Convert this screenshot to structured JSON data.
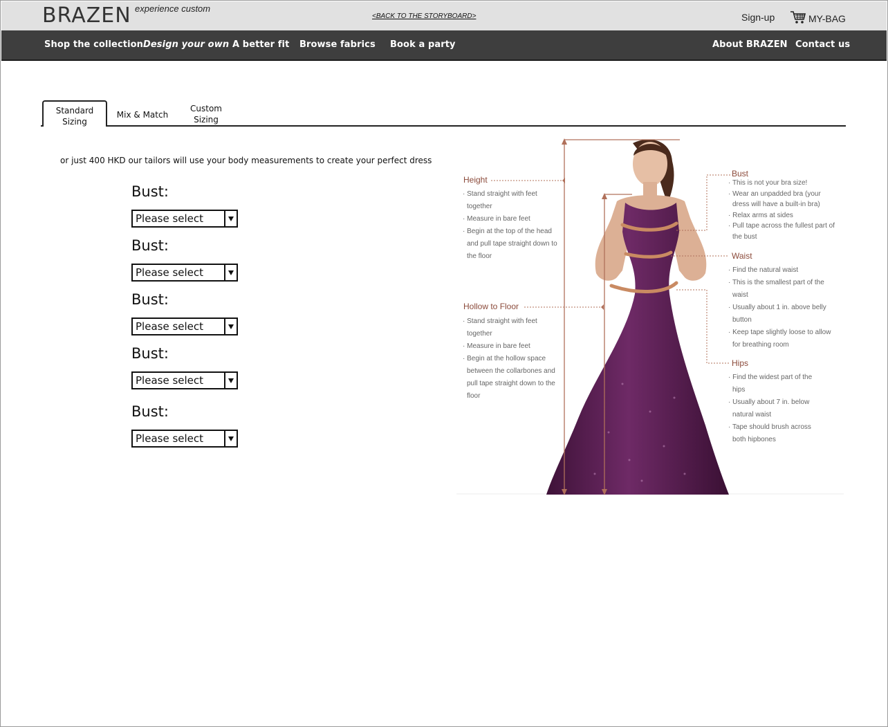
{
  "header": {
    "logo": "BRAZEN",
    "tagline": "experience custom",
    "back_link": "<BACK TO THE STORYBOARD>",
    "signup": "Sign-up",
    "bag": "MY-BAG"
  },
  "nav": {
    "items": [
      "Shop the collection",
      "Design your own",
      "A better fit",
      "Browse fabrics",
      "Book a party"
    ],
    "right_items": [
      "About BRAZEN",
      "Contact us"
    ]
  },
  "tabs": [
    {
      "label": "Standard Sizing",
      "active": true
    },
    {
      "label": "Mix & Match",
      "active": false
    },
    {
      "label": "Custom Sizing",
      "active": false
    }
  ],
  "main": {
    "intro": "or just 400 HKD our tailors will use your body measurements to create your perfect dress",
    "fields": [
      {
        "label": "Bust:",
        "value": "Please select"
      },
      {
        "label": "Bust:",
        "value": "Please select"
      },
      {
        "label": "Bust:",
        "value": "Please select"
      },
      {
        "label": "Bust:",
        "value": "Please select"
      },
      {
        "label": "Bust:",
        "value": "Please select"
      }
    ]
  },
  "guide": {
    "height": {
      "title": "Height",
      "items": [
        "Stand straight with feet together",
        "Measure in bare feet",
        "Begin at the top of the head and pull tape straight down to the floor"
      ]
    },
    "hollow": {
      "title": "Hollow to Floor",
      "items": [
        "Stand straight with feet together",
        "Measure in bare feet",
        "Begin at the hollow space between the collarbones and pull tape straight down to the floor"
      ]
    },
    "bust": {
      "title": "Bust",
      "items": [
        "This is not your bra size!",
        "Wear an unpadded bra (your dress will have a built-in bra)",
        "Relax arms at sides",
        "Pull tape across the fullest part of the bust"
      ]
    },
    "waist": {
      "title": "Waist",
      "items": [
        "Find the natural waist",
        "This is the smallest part of the waist",
        "Usually about 1 in. above belly button",
        "Keep tape slightly loose to allow for breathing room"
      ]
    },
    "hips": {
      "title": "Hips",
      "items": [
        "Find the widest part of the hips",
        "Usually about 7 in. below natural waist",
        "Tape should brush across both hipbones"
      ]
    }
  },
  "colors": {
    "nav_bg": "#3e3e3e",
    "topbar_bg": "#e1e1e1",
    "dress": "#5b2353",
    "measure_line": "#b0705a"
  }
}
